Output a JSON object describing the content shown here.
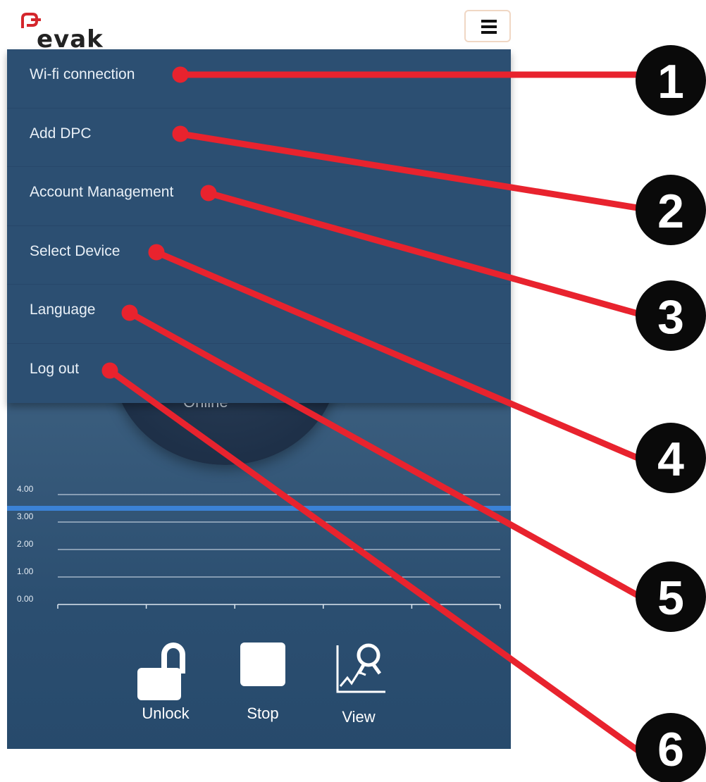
{
  "brand": {
    "name": "evak",
    "accent": "#d4262c"
  },
  "header": {
    "menu_icon": "hamburger-icon"
  },
  "menu": {
    "items": [
      {
        "label": "Wi-fi connection"
      },
      {
        "label": "Add DPC"
      },
      {
        "label": "Account Management"
      },
      {
        "label": "Select Device"
      },
      {
        "label": "Language"
      },
      {
        "label": "Log out"
      }
    ]
  },
  "status": {
    "text": "Online"
  },
  "chart_data": {
    "type": "line",
    "y_ticks": [
      "4.00",
      "3.00",
      "2.00",
      "1.00",
      "0.00"
    ],
    "ylim": [
      0,
      4
    ],
    "series": [
      {
        "values": [
          3.5,
          3.5
        ],
        "color": "#3b82d6"
      }
    ],
    "grid": true
  },
  "actions": {
    "unlock": {
      "label": "Unlock",
      "icon": "unlock-icon"
    },
    "stop": {
      "label": "Stop",
      "icon": "stop-icon"
    },
    "view": {
      "label": "View",
      "icon": "chart-search-icon"
    }
  },
  "callouts": [
    "1",
    "2",
    "3",
    "4",
    "5",
    "6"
  ],
  "colors": {
    "callout_line": "#e8232e",
    "callout_circle": "#0a0a0a",
    "menu_bg": "#2c4f72"
  }
}
